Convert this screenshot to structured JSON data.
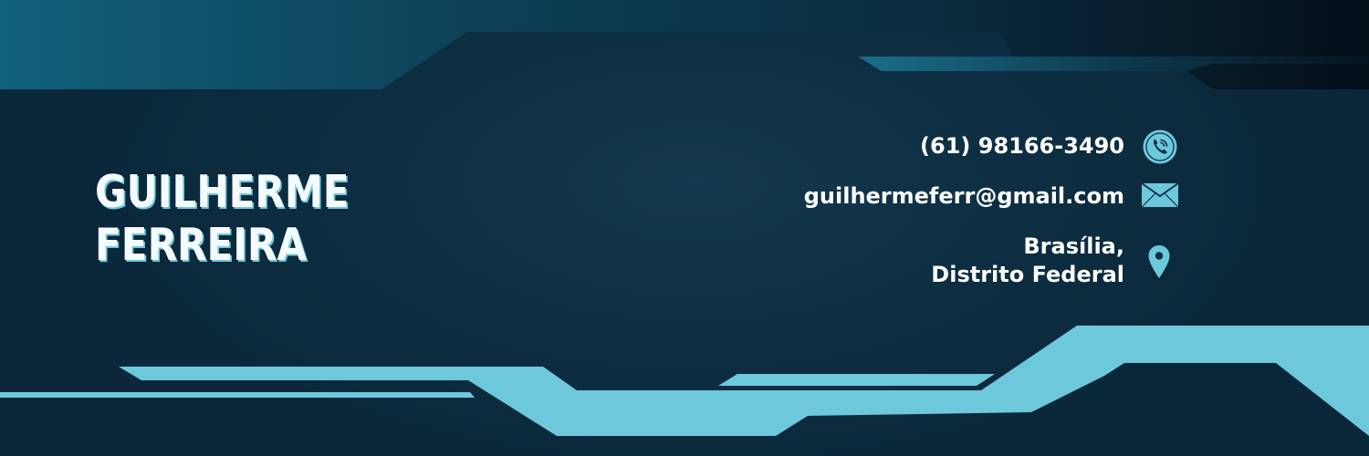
{
  "profile": {
    "first_name": "GUILHERME",
    "last_name": "FERREIRA"
  },
  "contact": {
    "phone": "(61) 98166-3490",
    "email": "guilhermeferr@gmail.com",
    "city": "Brasília,",
    "state": "Distrito Federal"
  },
  "icons": {
    "phone": "phone-icon",
    "email": "envelope-icon",
    "location": "map-pin-icon"
  },
  "colors": {
    "background": "#0c2d40",
    "accent": "#6ec8dc",
    "header_teal": "#0f5670",
    "text": "#ffffff"
  }
}
